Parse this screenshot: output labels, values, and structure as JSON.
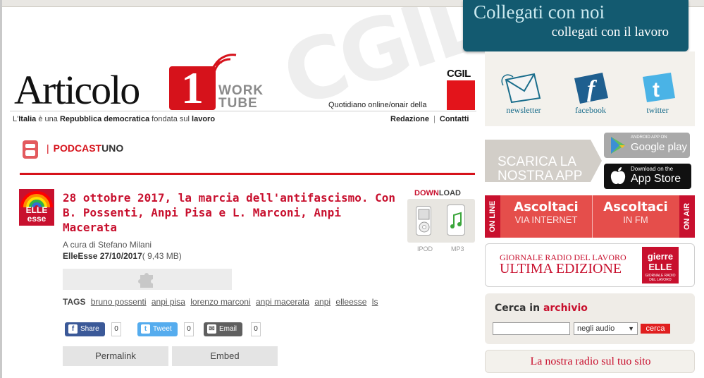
{
  "header": {
    "logo_word": "Articolo",
    "logo_number": "1",
    "logo_sub_1": "WORK",
    "logo_sub_2": "TUBE",
    "cgil_label": "CGIL",
    "quotidiano": "Quotidiano online/onair della",
    "tagline_parts": [
      "L'",
      "Italia",
      " è una ",
      "Repubblica democratica",
      " fondata sul ",
      "lavoro"
    ],
    "links": [
      "Redazione",
      "Contatti"
    ],
    "watermark": "CGIL"
  },
  "section": {
    "prefix": "PODCAST",
    "suffix": "UNO"
  },
  "article": {
    "badge_line1": "ELLE",
    "badge_line2": "esse",
    "title": "28 ottobre 2017, la marcia dell'antifascismo. Con B. Possenti, Anpi Pisa e L. Marconi, Anpi Macerata",
    "byline": "A cura di Stefano Milani",
    "date_bold": "ElleEsse 27/10/2017",
    "size": "( 9,43 MB)",
    "tags_label": "TAGS",
    "tags": [
      "bruno possenti",
      "anpi pisa",
      "lorenzo marconi",
      "anpi macerata",
      "anpi",
      "elleesse",
      "ls"
    ],
    "share": [
      {
        "label": "Share",
        "icon": "facebook-icon",
        "count": "0",
        "color": "#3b5998"
      },
      {
        "label": "Tweet",
        "icon": "twitter-icon",
        "count": "0",
        "color": "#55acee"
      },
      {
        "label": "Email",
        "icon": "email-icon",
        "count": "0",
        "color": "#5f5f5f"
      }
    ],
    "tabs": [
      "Permalink",
      "Embed"
    ]
  },
  "download": {
    "title_red": "DOWN",
    "title_dark": "LOAD",
    "ipod_label": "IPOD",
    "mp3_label": "MP3"
  },
  "sidebar": {
    "collegati_title": "Collegati con noi",
    "collegati_sub": "collegati con il lavoro",
    "social": [
      {
        "label": "newsletter",
        "icon": "newsletter-icon"
      },
      {
        "label": "facebook",
        "icon": "facebook-icon"
      },
      {
        "label": "twitter",
        "icon": "twitter-icon"
      }
    ],
    "app_line1": "SCARICA LA",
    "app_line2": "NOSTRA APP",
    "google_small": "ANDROID APP ON",
    "google_big": "Google play",
    "apple_small": "Download on the",
    "apple_big": "App Store",
    "on_line": "ON LINE",
    "on_air": "ON AIR",
    "ascolta_web_h": "Ascoltaci",
    "ascolta_web_s": "VIA INTERNET",
    "ascolta_fm_h": "Ascoltaci",
    "ascolta_fm_s": "IN FM",
    "gr_line1": "GIORNALE RADIO DEL LAVORO",
    "gr_line2": "ULTIMA EDIZIONE",
    "gr_logo_1": "gierre",
    "gr_logo_2": "ELLE",
    "gr_logo_3": "GIORNALE RADIO DEL LAVORO",
    "cerca_prefix": "Cerca in ",
    "cerca_red": "archivio",
    "search_value": "",
    "select_value": "negli audio",
    "cerca_button": "cerca",
    "radio_banner": "La nostra radio sul tuo sito"
  },
  "colors": {
    "brand_red": "#c8102e",
    "teal": "#135a70"
  }
}
